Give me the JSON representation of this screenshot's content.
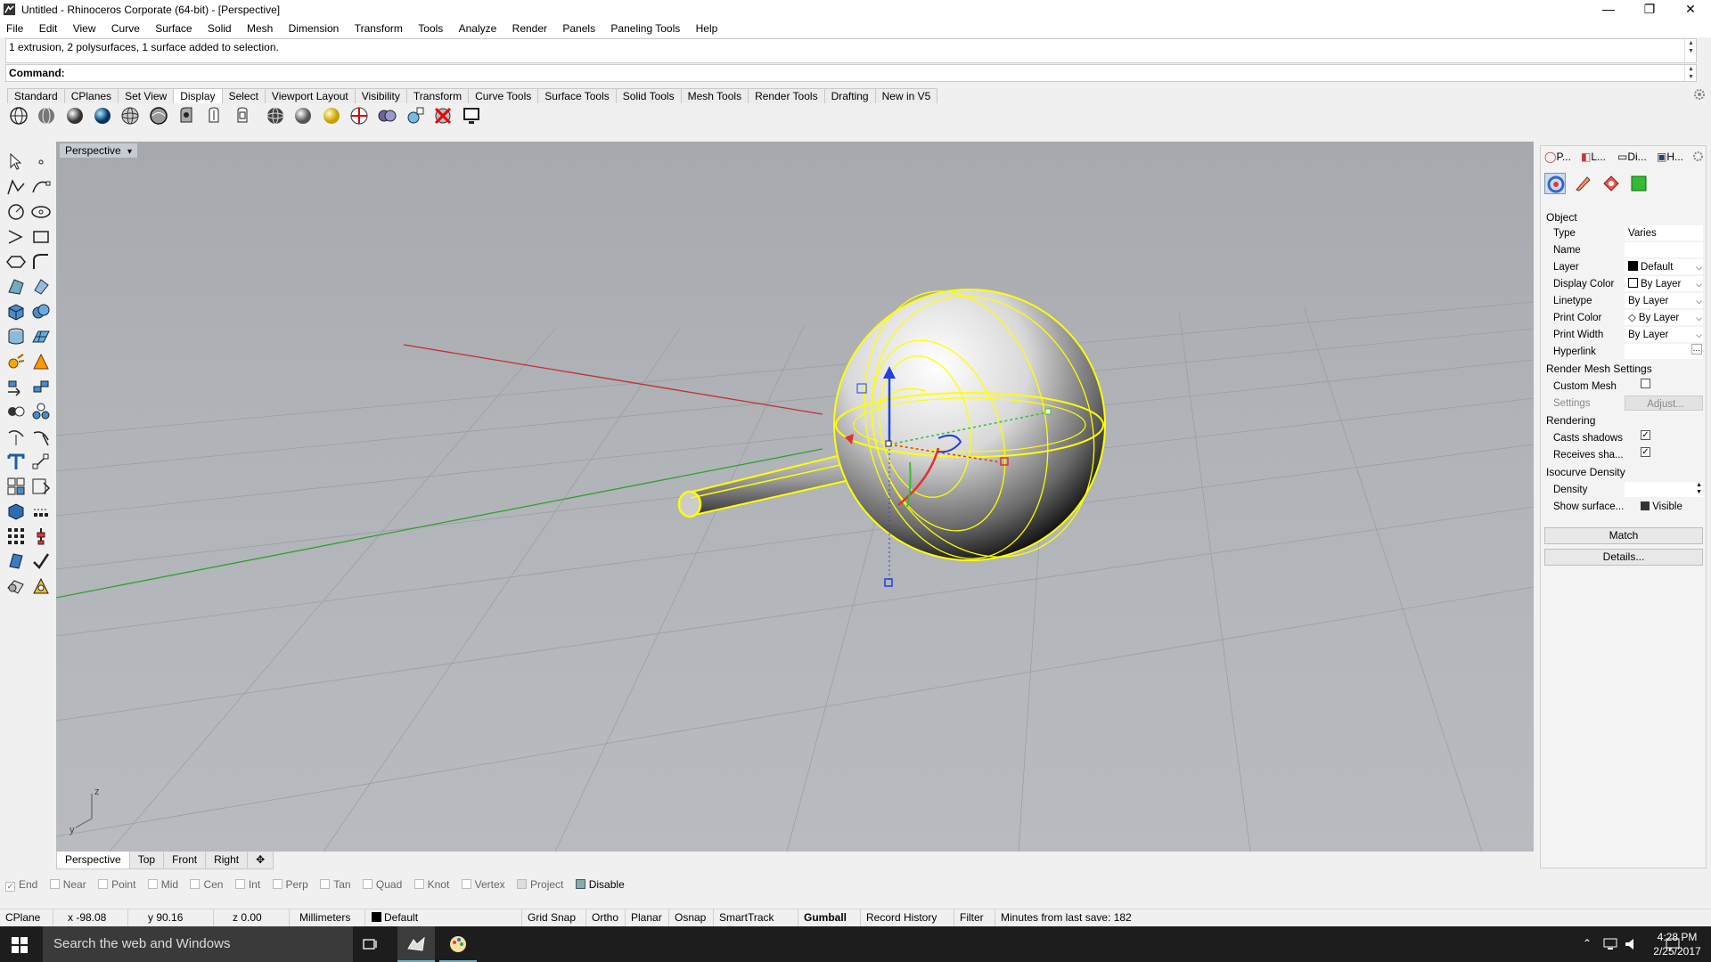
{
  "window": {
    "title": "Untitled - Rhinoceros Corporate (64-bit) - [Perspective]",
    "controls": [
      "—",
      "❐",
      "✕"
    ]
  },
  "menu": [
    "File",
    "Edit",
    "View",
    "Curve",
    "Surface",
    "Solid",
    "Mesh",
    "Dimension",
    "Transform",
    "Tools",
    "Analyze",
    "Render",
    "Panels",
    "Paneling Tools",
    "Help"
  ],
  "command": {
    "history": "1 extrusion, 2 polysurfaces, 1 surface added to selection.",
    "prompt": "Command:"
  },
  "toolbar_tabs": {
    "items": [
      "Standard",
      "CPlanes",
      "Set View",
      "Display",
      "Select",
      "Viewport Layout",
      "Visibility",
      "Transform",
      "Curve Tools",
      "Surface Tools",
      "Solid Tools",
      "Mesh Tools",
      "Render Tools",
      "Drafting",
      "New in V5"
    ],
    "active": "Display"
  },
  "display_tools": [
    "wireframe-icon",
    "shaded-icon",
    "rendered-icon",
    "ghosted-icon",
    "xray-icon",
    "technical-icon",
    "artistic-icon",
    "pen-icon",
    "arctic-icon",
    "raytraced-icon",
    "mesh-display-icon",
    "sphere-display-icon",
    "light-sphere-icon",
    "zebra-icon",
    "env-map-icon",
    "curvature-icon",
    "draft-angle-icon",
    "screen-icon"
  ],
  "viewport": {
    "label": "Perspective",
    "axis_z": "z",
    "axis_y": "y"
  },
  "viewport_tabs": {
    "items": [
      "Perspective",
      "Top",
      "Front",
      "Right"
    ],
    "active": "Perspective",
    "add": "✥"
  },
  "osnaps": [
    {
      "label": "End",
      "checked": true
    },
    {
      "label": "Near",
      "checked": false
    },
    {
      "label": "Point",
      "checked": false
    },
    {
      "label": "Mid",
      "checked": false
    },
    {
      "label": "Cen",
      "checked": false
    },
    {
      "label": "Int",
      "checked": false
    },
    {
      "label": "Perp",
      "checked": false
    },
    {
      "label": "Tan",
      "checked": false
    },
    {
      "label": "Quad",
      "checked": false
    },
    {
      "label": "Knot",
      "checked": false
    },
    {
      "label": "Vertex",
      "checked": false
    },
    {
      "label": "Project",
      "checked": false
    },
    {
      "label": "Disable",
      "checked": false
    }
  ],
  "status": {
    "cplane": "CPlane",
    "x": "x -98.08",
    "y": "y 90.16",
    "z": "z 0.00",
    "units": "Millimeters",
    "layer": "Default",
    "grid_snap": "Grid Snap",
    "ortho": "Ortho",
    "planar": "Planar",
    "osnap": "Osnap",
    "smarttrack": "SmartTrack",
    "gumball": "Gumball",
    "record_history": "Record History",
    "filter": "Filter",
    "save_info": "Minutes from last save: 182"
  },
  "panel": {
    "tabs": [
      "P...",
      "L...",
      "Di...",
      "H..."
    ],
    "section_object": "Object",
    "props": [
      {
        "key": "Type",
        "value": "Varies"
      },
      {
        "key": "Name",
        "value": ""
      },
      {
        "key": "Layer",
        "value": "Default"
      },
      {
        "key": "Display Color",
        "value": "By Layer"
      },
      {
        "key": "Linetype",
        "value": "By Layer"
      },
      {
        "key": "Print Color",
        "value": "By Layer"
      },
      {
        "key": "Print Width",
        "value": "By Layer"
      },
      {
        "key": "Hyperlink",
        "value": ""
      }
    ],
    "section_mesh": "Render Mesh Settings",
    "custom_mesh": "Custom Mesh",
    "settings": "Settings",
    "adjust": "Adjust...",
    "section_rendering": "Rendering",
    "casts_shadows": "Casts shadows",
    "receives_shadows": "Receives sha...",
    "section_isocurve": "Isocurve Density",
    "density": "Density",
    "show_surface": "Show surface...",
    "visible": "Visible",
    "match": "Match",
    "details": "Details..."
  },
  "taskbar": {
    "search_placeholder": "Search the web and Windows",
    "time": "4:28 PM",
    "date": "2/25/2017"
  },
  "colors": {
    "selection": "#ffff00",
    "x_axis": "#c03030",
    "y_axis": "#30a030",
    "gumball_z": "#2040e0"
  }
}
